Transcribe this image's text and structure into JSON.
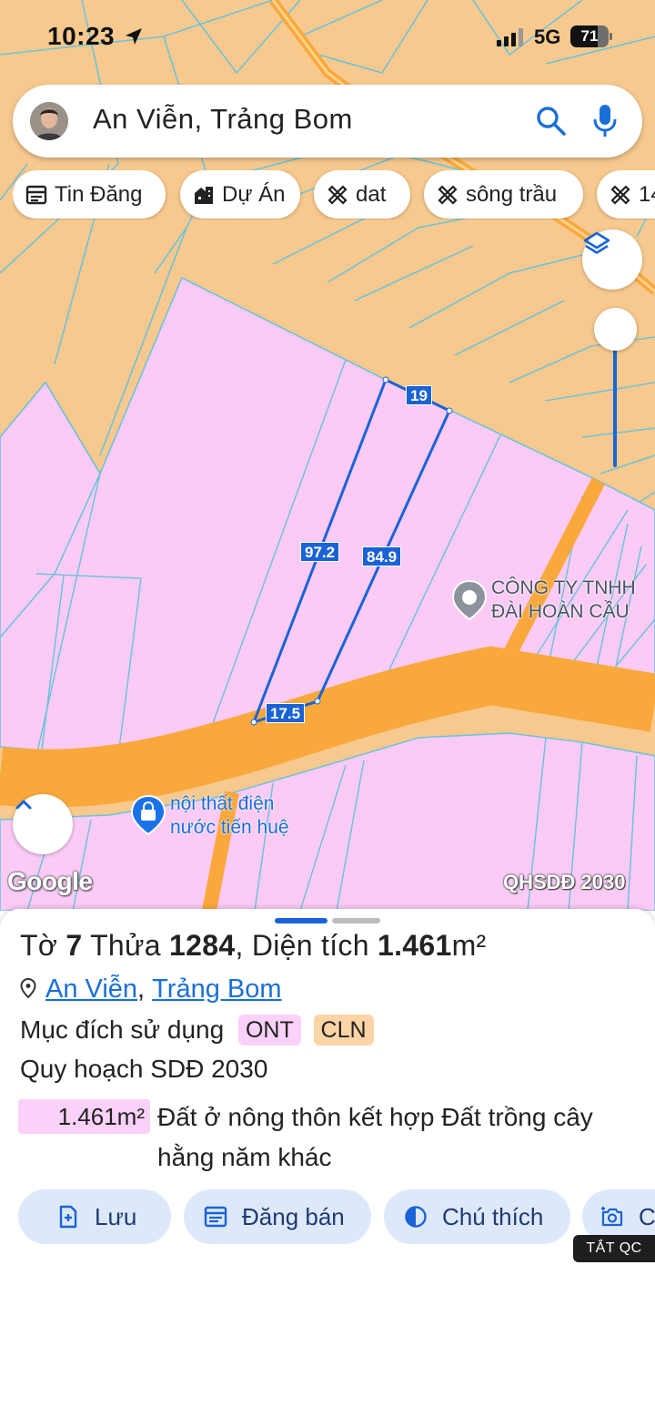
{
  "status_bar": {
    "time": "10:23",
    "network": "5G",
    "battery": "71",
    "battery_level_percent": 71
  },
  "search": {
    "query": "An Viễn, Trảng Bom"
  },
  "chips": [
    {
      "label": "Tin Đăng",
      "icon": "listing-icon"
    },
    {
      "label": "Dự Án",
      "icon": "building-icon"
    },
    {
      "label": "dat",
      "icon": "ruler-icon"
    },
    {
      "label": "sông trầu",
      "icon": "ruler-icon"
    },
    {
      "label": "14",
      "icon": "ruler-icon"
    }
  ],
  "map": {
    "colors": {
      "residential": "#fbcbf6",
      "perennial": "#f7c98e",
      "road": "#f9a83c",
      "boundary": "#6ec3d9",
      "measure": "#1a63d6"
    },
    "measurements": [
      "19",
      "97.2",
      "84.9",
      "17.5"
    ],
    "pois": {
      "company": [
        "CÔNG TY TNHH",
        "ĐÀI HOÀN CẦU"
      ],
      "shop": [
        "nội thất điện",
        "nước tiến huệ"
      ]
    },
    "google": "Google",
    "layer_name": "QHSDĐ 2030"
  },
  "sheet": {
    "title": {
      "sheet_prefix": "Tờ",
      "sheet_no": "7",
      "parcel_prefix": "Thửa",
      "parcel_no": "1284",
      "area_prefix": ", Diện tích",
      "area_value": "1.461",
      "area_unit": "m²"
    },
    "location": {
      "ward": "An Viễn",
      "separator": ",",
      "district": "Trảng Bom"
    },
    "usage_label": "Mục đích sử dụng",
    "usage_tags": [
      {
        "label": "ONT",
        "color": "#fad1f8"
      },
      {
        "label": "CLN",
        "color": "#fdd4a6"
      }
    ],
    "plan_label": "Quy hoạch SDĐ 2030",
    "plan_area": "1.461m²",
    "plan_desc": "Đất ở nông thôn kết hợp Đất trồng cây hằng năm khác",
    "actions": [
      {
        "label": "Lưu",
        "icon": "bookmark-add-icon"
      },
      {
        "label": "Đăng bán",
        "icon": "listing-icon"
      },
      {
        "label": "Chú thích",
        "icon": "contrast-icon"
      },
      {
        "label": "C",
        "icon": "camera-icon"
      }
    ],
    "ads_badge": "TẮT QC"
  }
}
